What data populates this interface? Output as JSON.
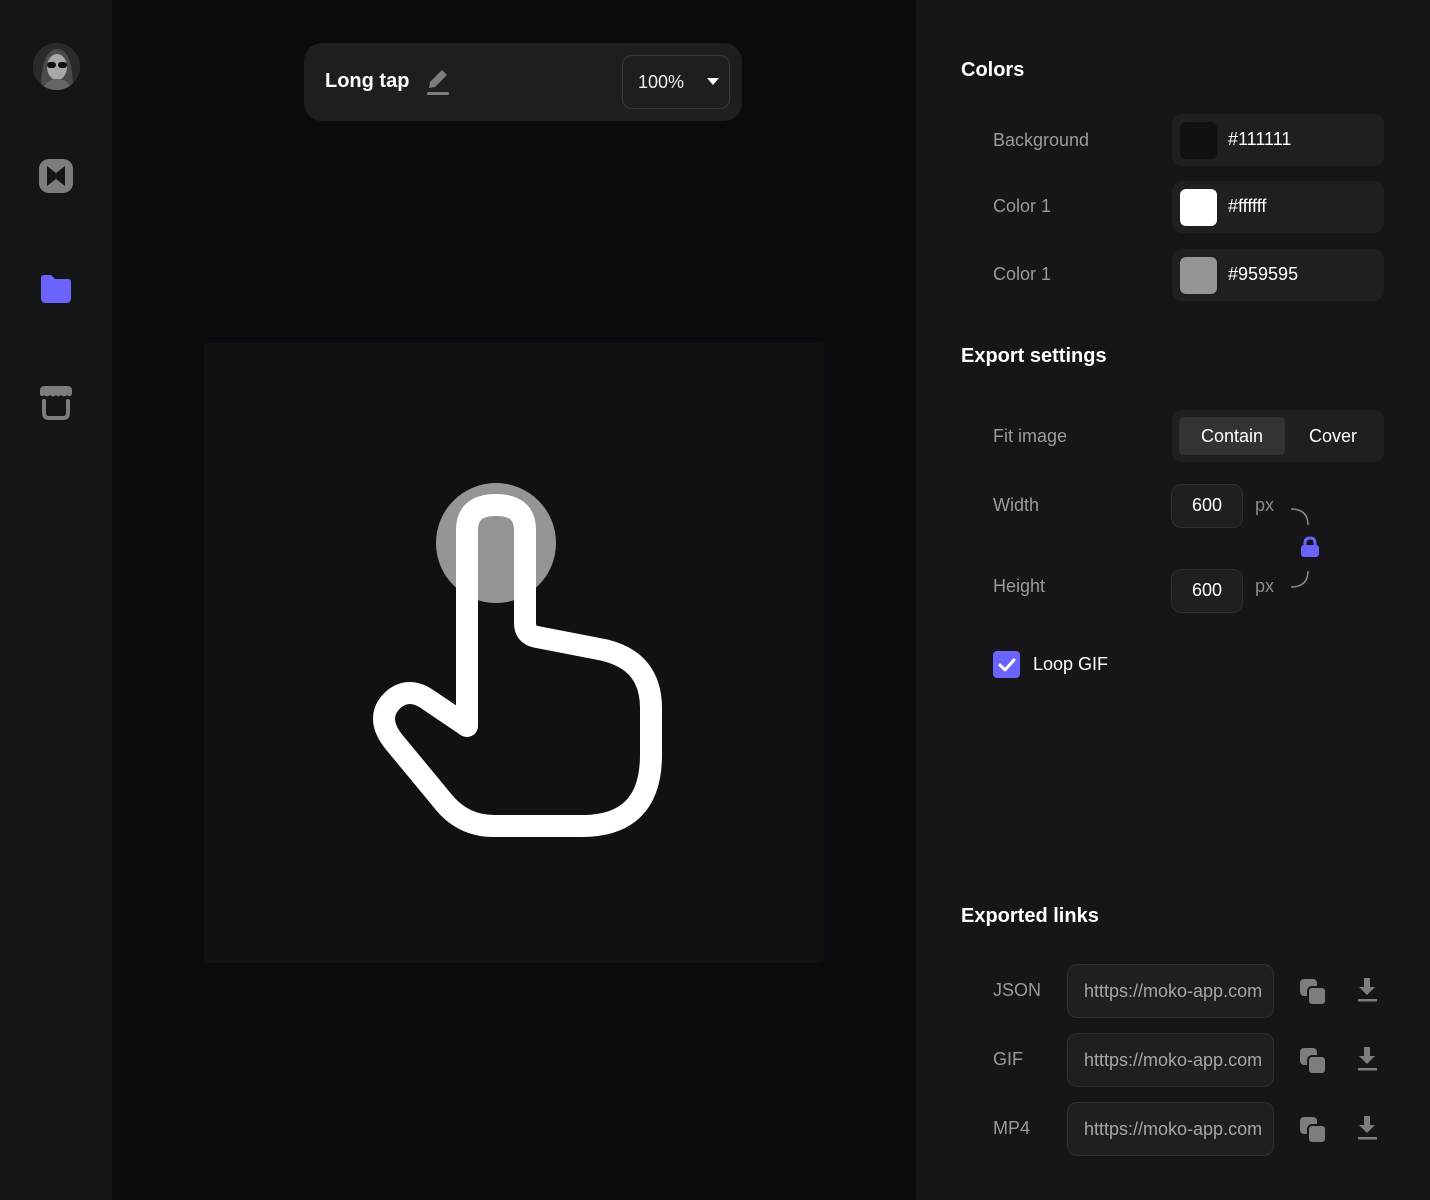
{
  "sidebar": {
    "items": [
      {
        "name": "avatar",
        "icon": "user-avatar"
      },
      {
        "name": "logo",
        "icon": "bowtie-logo-icon"
      },
      {
        "name": "projects",
        "icon": "folder-icon",
        "active": true
      },
      {
        "name": "store",
        "icon": "store-icon"
      }
    ],
    "accent_color": "#6b63ff",
    "icon_color": "#7d7d80"
  },
  "toolbar": {
    "title": "Long tap",
    "edit_icon": "pencil-icon",
    "zoom_value": "100%"
  },
  "canvas": {
    "background": "#111111",
    "animation": "long-tap-hand",
    "hand_color": "#ffffff",
    "ripple_color": "#959595"
  },
  "colors": {
    "heading": "Colors",
    "items": [
      {
        "label": "Background",
        "hex": "#111111"
      },
      {
        "label": "Color 1",
        "hex": "#ffffff"
      },
      {
        "label": "Color 1",
        "hex": "#959595"
      }
    ]
  },
  "export": {
    "heading": "Export settings",
    "fit_label": "Fit image",
    "fit_options": [
      "Contain",
      "Cover"
    ],
    "fit_selected": "Contain",
    "width_label": "Width",
    "width_value": "600",
    "height_label": "Height",
    "height_value": "600",
    "unit": "px",
    "aspect_locked": true,
    "loop_label": "Loop GIF",
    "loop_checked": true
  },
  "links": {
    "heading": "Exported links",
    "items": [
      {
        "label": "JSON",
        "url": "htttps://moko-app.com"
      },
      {
        "label": "GIF",
        "url": "htttps://moko-app.com"
      },
      {
        "label": "MP4",
        "url": "htttps://moko-app.com"
      }
    ]
  }
}
